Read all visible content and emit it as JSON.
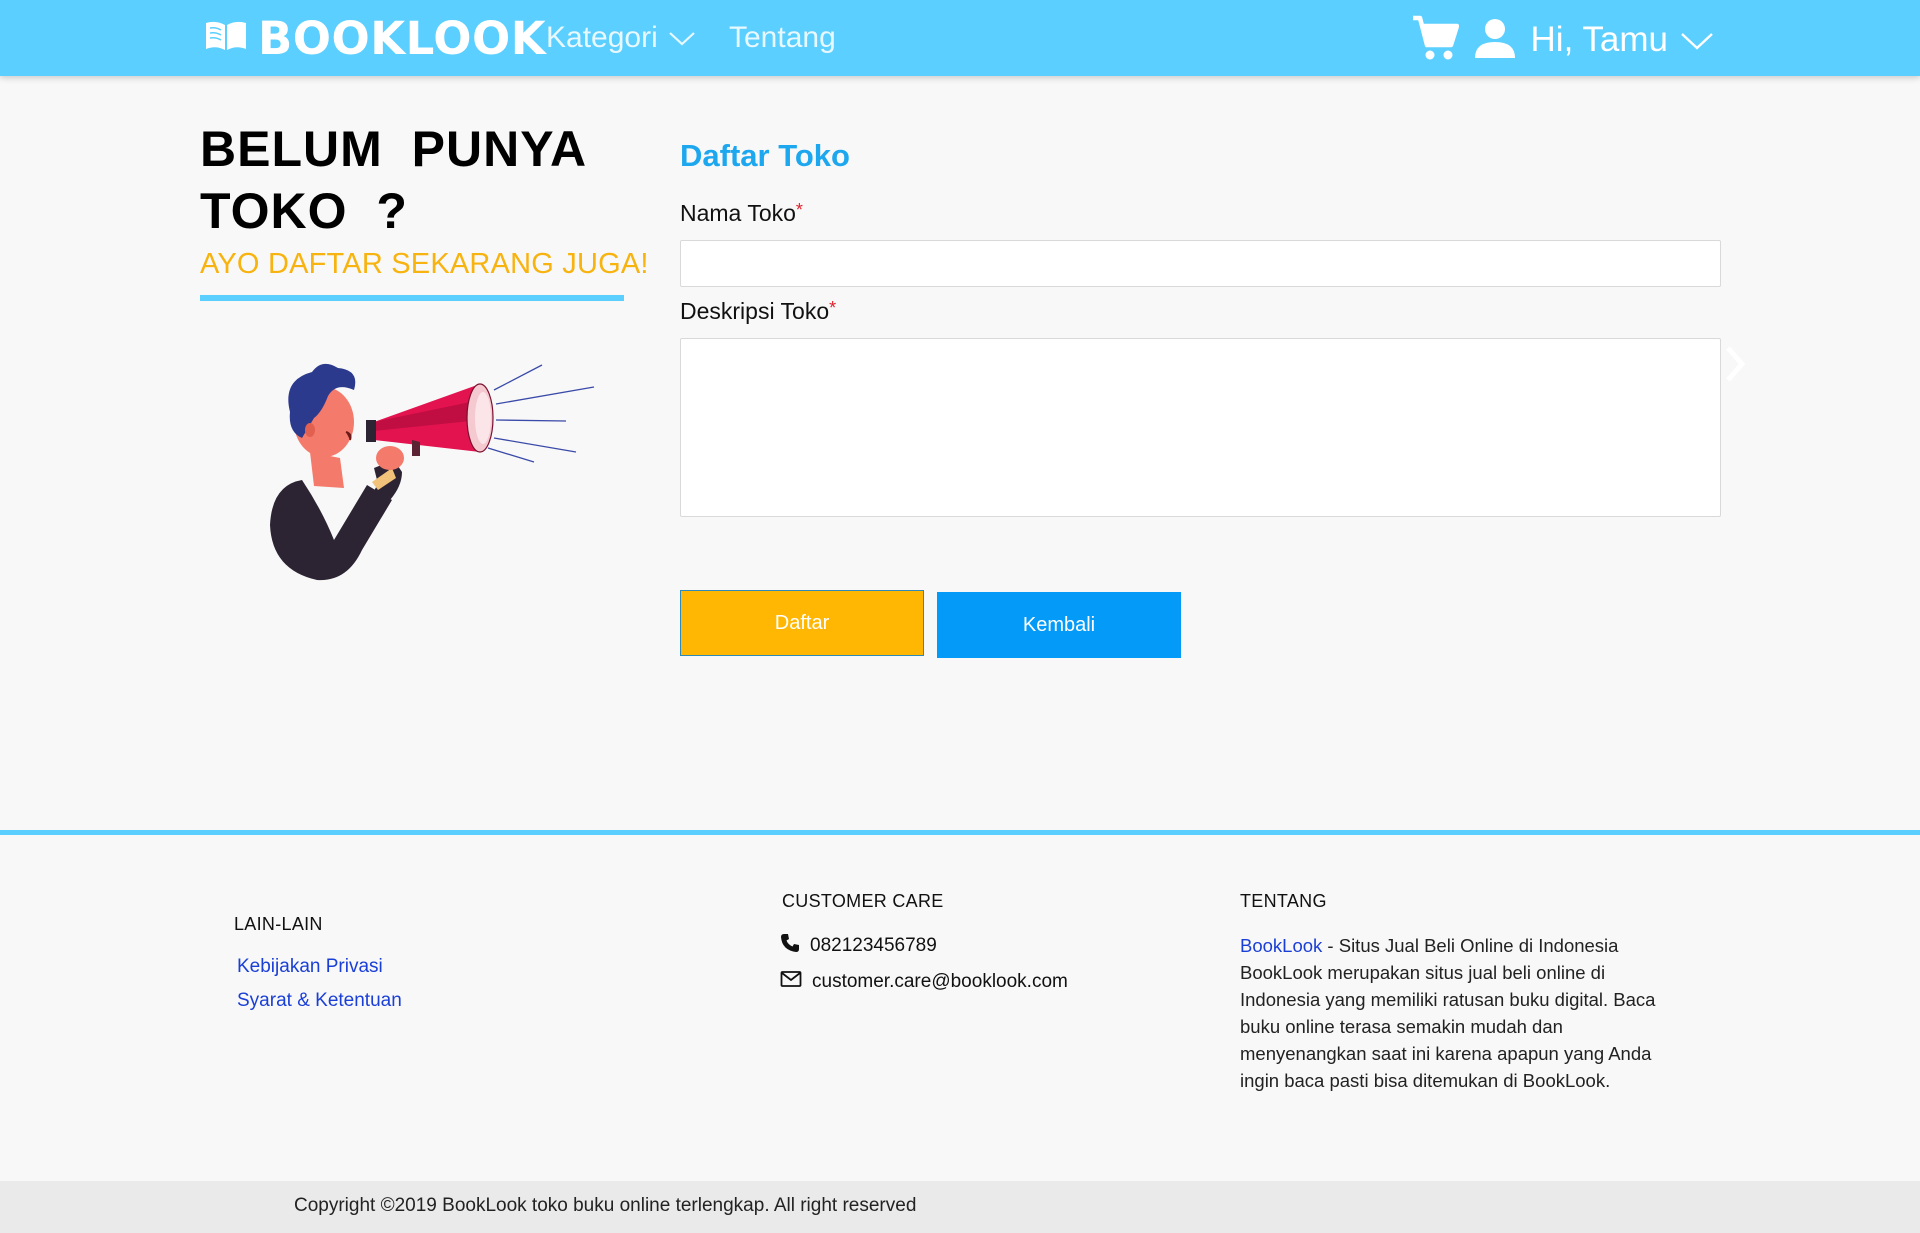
{
  "navbar": {
    "brand": "BOOKLOOK",
    "kategori": "Kategori",
    "tentang": "Tentang",
    "greeting": "Hi, Tamu"
  },
  "promo": {
    "title": "BELUM PUNYA TOKO ?",
    "subtitle": "AYO DAFTAR SEKARANG JUGA!"
  },
  "form": {
    "title": "Daftar Toko",
    "nama_label": "Nama Toko",
    "deskripsi_label": "Deskripsi Toko",
    "required_mark": "*",
    "nama_value": "",
    "deskripsi_value": "",
    "submit_label": "Daftar",
    "back_label": "Kembali"
  },
  "footer": {
    "lain_lain": {
      "heading": "LAIN-LAIN",
      "links": [
        "Kebijakan Privasi",
        "Syarat & Ketentuan"
      ]
    },
    "customer_care": {
      "heading": "CUSTOMER CARE",
      "phone": "082123456789",
      "email": "customer.care@booklook.com"
    },
    "tentang": {
      "heading": "TENTANG",
      "brand": "BookLook",
      "tagline": " - Situs Jual Beli Online di Indonesia",
      "description": "BookLook merupakan situs jual beli online di Indonesia yang memiliki ratusan buku digital. Baca buku online terasa semakin mudah dan menyenangkan saat ini karena apapun yang Anda ingin baca pasti bisa ditemukan di BookLook."
    },
    "copyright": "Copyright ©2019 BookLook toko buku online terlengkap. All right reserved"
  },
  "colors": {
    "navbar": "#5bcfff",
    "accent_yellow": "#ffb703",
    "accent_blue": "#049af7",
    "title_blue": "#1da7ee",
    "link_blue": "#1a3fd6"
  },
  "icons": [
    "book-icon",
    "chevron-down-icon",
    "cart-icon",
    "user-icon",
    "chevron-right-icon",
    "phone-icon",
    "mail-icon"
  ]
}
